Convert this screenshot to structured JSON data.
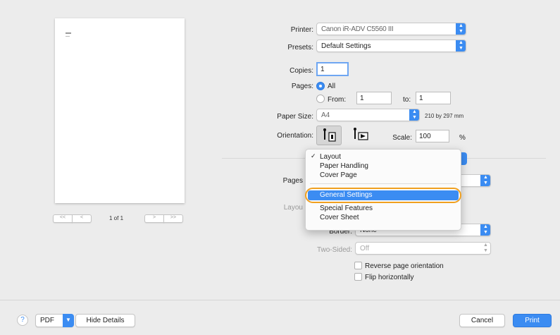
{
  "preview": {
    "page_indicator": "1 of 1"
  },
  "printer": {
    "label": "Printer:",
    "value": "Canon iR-ADV C5560 III"
  },
  "presets": {
    "label": "Presets:",
    "value": "Default Settings"
  },
  "copies": {
    "label": "Copies:",
    "value": "1"
  },
  "pages": {
    "label": "Pages:",
    "all_label": "All",
    "from_label": "From:",
    "from_value": "1",
    "to_label": "to:",
    "to_value": "1"
  },
  "paper_size": {
    "label": "Paper Size:",
    "value": "A4",
    "dimensions": "210 by 297 mm"
  },
  "orientation": {
    "label": "Orientation:"
  },
  "scale": {
    "label": "Scale:",
    "value": "100",
    "unit": "%"
  },
  "layout_section": {
    "pages_per_sheet_label": "Pages",
    "layout_label": "Layou",
    "border_label": "Border:",
    "border_value": "None",
    "two_sided_label": "Two-Sided:",
    "two_sided_value": "Off"
  },
  "options": {
    "reverse_label": "Reverse page orientation",
    "flip_label": "Flip horizontally"
  },
  "menu": {
    "check": "✓",
    "items": [
      "Layout",
      "Paper Handling",
      "Cover Page",
      "General Settings",
      "Special Features",
      "Cover Sheet"
    ]
  },
  "footer": {
    "help": "?",
    "pdf": "PDF",
    "hide_details": "Hide Details",
    "cancel": "Cancel",
    "print": "Print"
  },
  "colors": {
    "accent": "#3b8cf2",
    "highlight_ring": "#f0a020"
  }
}
